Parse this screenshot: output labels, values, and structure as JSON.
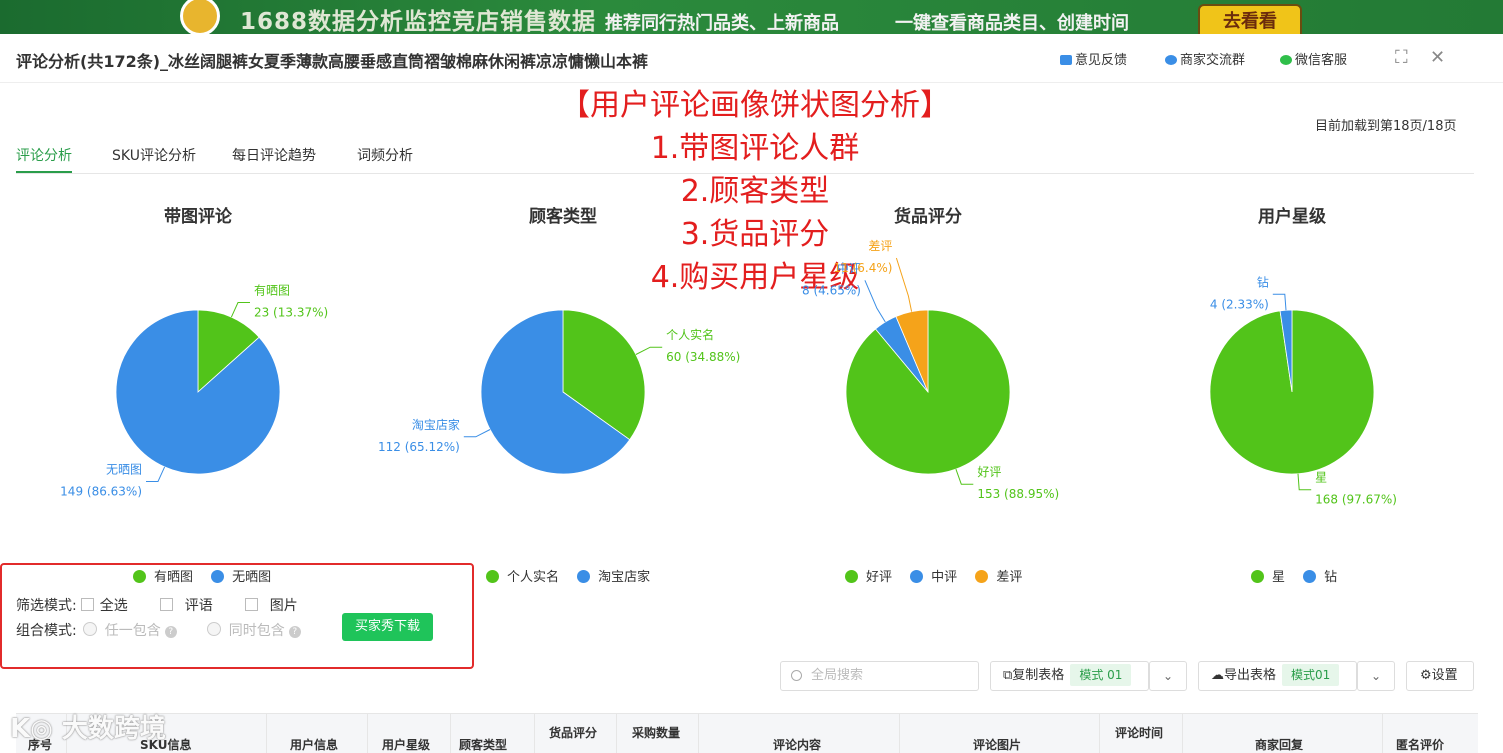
{
  "banner": {
    "headline": "1688数据分析监控竞店销售数据",
    "promo1": "推荐同行热门品类、上新商品",
    "promo2": "一键查看商品类目、创建时间",
    "cta": "去看看"
  },
  "header": {
    "title": "评论分析(共172条)_冰丝阔腿裤女夏季薄款高腰垂感直筒褶皱棉麻休闲裤凉凉慵懒山本裤",
    "links": [
      "意见反馈",
      "商家交流群",
      "微信客服"
    ]
  },
  "annotation": [
    "【用户评论画像饼状图分析】",
    "1.带图评论人群",
    "2.顾客类型",
    "3.货品评分",
    "4.购买用户星级"
  ],
  "loaded_text": "目前加载到第18页/18页",
  "tabs": [
    "评论分析",
    "SKU评论分析",
    "每日评论趋势",
    "词频分析"
  ],
  "colors": {
    "green": "#52c41a",
    "blue": "#3a8ee6",
    "orange": "#f5a31a",
    "accent": "#2a9d4a",
    "annotation": "#e31e1e"
  },
  "chart_data": [
    {
      "type": "pie",
      "title": "带图评论",
      "slices": [
        {
          "name": "有晒图",
          "value": 23,
          "percent": "13.37%",
          "color": "#52c41a"
        },
        {
          "name": "无晒图",
          "value": 149,
          "percent": "86.63%",
          "color": "#3a8ee6"
        }
      ]
    },
    {
      "type": "pie",
      "title": "顾客类型",
      "slices": [
        {
          "name": "个人实名",
          "value": 60,
          "percent": "34.88%",
          "color": "#52c41a"
        },
        {
          "name": "淘宝店家",
          "value": 112,
          "percent": "65.12%",
          "color": "#3a8ee6"
        }
      ]
    },
    {
      "type": "pie",
      "title": "货品评分",
      "slices": [
        {
          "name": "好评",
          "value": 153,
          "percent": "88.95%",
          "color": "#52c41a"
        },
        {
          "name": "中评",
          "value": 8,
          "percent": "4.65%",
          "color": "#3a8ee6"
        },
        {
          "name": "差评",
          "value": 11,
          "percent": "6.4%",
          "color": "#f5a31a"
        }
      ]
    },
    {
      "type": "pie",
      "title": "用户星级",
      "slices": [
        {
          "name": "星",
          "value": 168,
          "percent": "97.67%",
          "color": "#52c41a"
        },
        {
          "name": "钻",
          "value": 4,
          "percent": "2.33%",
          "color": "#3a8ee6"
        }
      ]
    }
  ],
  "filter": {
    "mode_label": "筛选模式:",
    "options": [
      "全选",
      "评语",
      "图片"
    ],
    "combo_label": "组合模式:",
    "combo_options": [
      "任一包含",
      "同时包含"
    ],
    "download_button": "买家秀下载"
  },
  "toolbar": {
    "search_placeholder": "全局搜索",
    "copy_table": "复制表格",
    "copy_mode": "模式 01",
    "export_table": "导出表格",
    "export_mode": "模式01",
    "settings": "设置"
  },
  "table_headers": [
    "序号",
    "SKU信息",
    "用户信息",
    "用户星级",
    "顾客类型",
    "货品评分",
    "采购数量",
    "评论内容",
    "评论图片",
    "评论时间",
    "商家回复",
    "匿名评价"
  ],
  "watermark": "大数跨境"
}
